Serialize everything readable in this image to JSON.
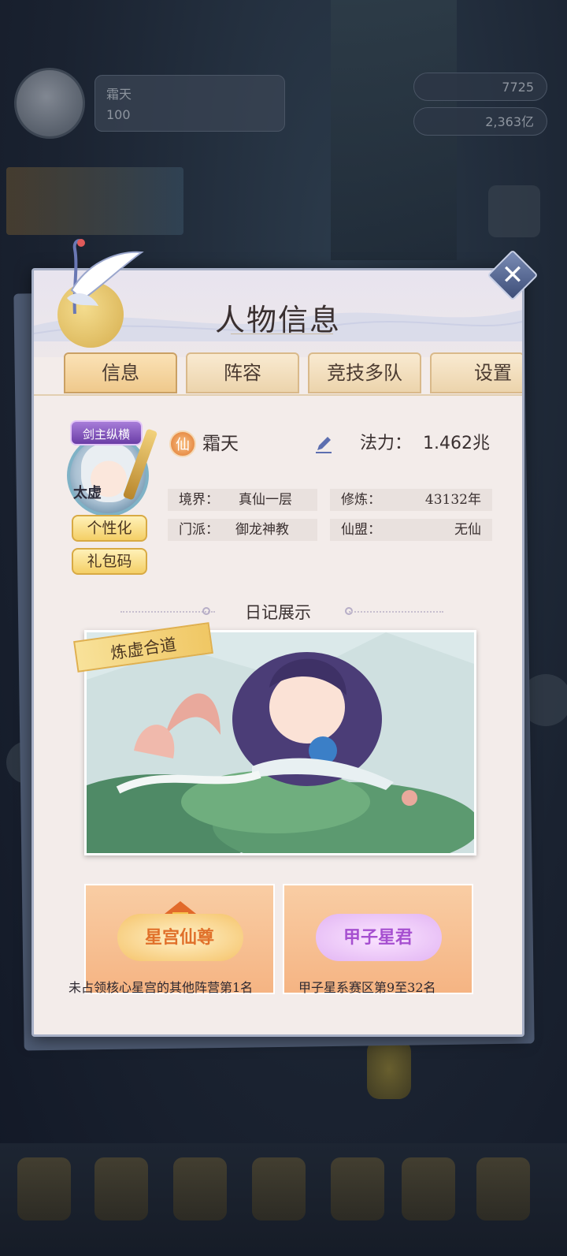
{
  "background": {
    "player_level_label": "100",
    "res1": "7725",
    "res2": "2,363亿"
  },
  "panel": {
    "title": "人物信息",
    "close_label": "✕",
    "tabs": [
      {
        "label": "信息",
        "active": true
      },
      {
        "label": "阵容",
        "active": false
      },
      {
        "label": "竞技多队",
        "active": false
      },
      {
        "label": "设置",
        "active": false
      }
    ]
  },
  "profile": {
    "badge": "剑主纵横",
    "avatar_tag": "太虚",
    "customize_button": "个性化",
    "gift_code_button": "礼包码",
    "rank_icon_text": "仙",
    "name": "霜天",
    "power_label": "法力：",
    "power_value": "1.462兆",
    "realm_label": "境界：",
    "realm_value": "真仙一层",
    "cultivation_label": "修炼：",
    "cultivation_value": "43132年",
    "sect_label": "门派：",
    "sect_value": "御龙神教",
    "alliance_label": "仙盟：",
    "alliance_value": "无仙"
  },
  "diary": {
    "title": "日记展示",
    "label": "炼虚合道"
  },
  "medals": [
    {
      "name": "星宫仙尊",
      "caption": "未占领核心星宫的其他阵营第1名",
      "color": "#e98a2c"
    },
    {
      "name": "甲子星君",
      "caption": "甲子星系赛区第9至32名",
      "color": "#b66ad6"
    }
  ]
}
